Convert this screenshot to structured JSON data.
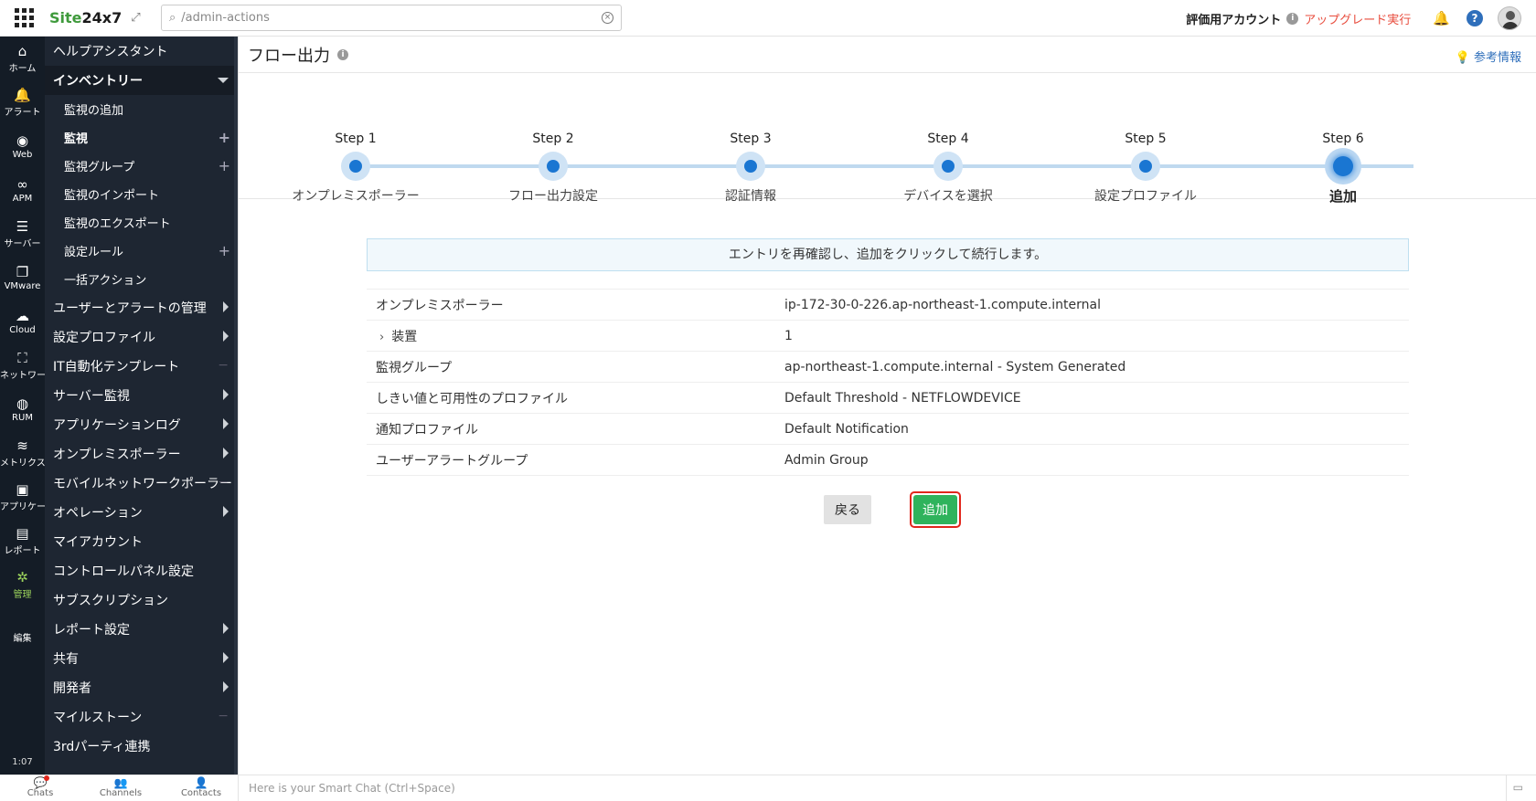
{
  "topbar": {
    "logo_main": "Site24x7",
    "search_value": "/admin-actions",
    "account_label": "評価用アカウント",
    "upgrade_label": "アップグレード実行",
    "help_label": "?"
  },
  "rail": {
    "items": [
      {
        "label": "ホーム",
        "icon": "home-icon",
        "glyph": "⌂"
      },
      {
        "label": "アラート",
        "icon": "bell-icon",
        "glyph": "🔔"
      },
      {
        "label": "Web",
        "icon": "globe-icon",
        "glyph": "◉"
      },
      {
        "label": "APM",
        "icon": "binoculars-icon",
        "glyph": "∞"
      },
      {
        "label": "サーバー",
        "icon": "server-icon",
        "glyph": "☰"
      },
      {
        "label": "VMware",
        "icon": "vmware-icon",
        "glyph": "❐"
      },
      {
        "label": "Cloud",
        "icon": "cloud-icon",
        "glyph": "☁"
      },
      {
        "label": "ネットワーク",
        "icon": "network-icon",
        "glyph": "⛶"
      },
      {
        "label": "RUM",
        "icon": "rum-icon",
        "glyph": "◍"
      },
      {
        "label": "メトリクス",
        "icon": "layers-icon",
        "glyph": "≋"
      },
      {
        "label": "アプリケーション",
        "icon": "app-icon",
        "glyph": "▣"
      },
      {
        "label": "レポート",
        "icon": "report-icon",
        "glyph": "▤"
      },
      {
        "label": "管理",
        "icon": "gear-icon",
        "glyph": "✲"
      },
      {
        "label": "編集",
        "icon": "edit-icon",
        "glyph": ""
      }
    ],
    "time": "1:07"
  },
  "sidebar": {
    "items": [
      {
        "label": "ヘルプアシスタント",
        "type": "top",
        "marker": ""
      },
      {
        "label": "インベントリー",
        "type": "section",
        "marker": "down"
      },
      {
        "label": "監視の追加",
        "type": "sub",
        "marker": ""
      },
      {
        "label": "監視",
        "type": "sub-bold",
        "marker": "plus"
      },
      {
        "label": "監視グループ",
        "type": "sub",
        "marker": "plus"
      },
      {
        "label": "監視のインポート",
        "type": "sub",
        "marker": ""
      },
      {
        "label": "監視のエクスポート",
        "type": "sub",
        "marker": ""
      },
      {
        "label": "設定ルール",
        "type": "sub",
        "marker": "plus"
      },
      {
        "label": "一括アクション",
        "type": "sub",
        "marker": ""
      },
      {
        "label": "ユーザーとアラートの管理",
        "type": "top",
        "marker": "arrow"
      },
      {
        "label": "設定プロファイル",
        "type": "top",
        "marker": "arrow"
      },
      {
        "label": "IT自動化テンプレート",
        "type": "top",
        "marker": "minus"
      },
      {
        "label": "サーバー監視",
        "type": "top",
        "marker": "arrow"
      },
      {
        "label": "アプリケーションログ",
        "type": "top",
        "marker": "arrow"
      },
      {
        "label": "オンプレミスポーラー",
        "type": "top",
        "marker": "arrow"
      },
      {
        "label": "モバイルネットワークポーラー",
        "type": "top",
        "marker": "minus"
      },
      {
        "label": "オペレーション",
        "type": "top",
        "marker": "arrow"
      },
      {
        "label": "マイアカウント",
        "type": "top",
        "marker": ""
      },
      {
        "label": "コントロールパネル設定",
        "type": "top",
        "marker": ""
      },
      {
        "label": "サブスクリプション",
        "type": "top",
        "marker": ""
      },
      {
        "label": "レポート設定",
        "type": "top",
        "marker": "arrow"
      },
      {
        "label": "共有",
        "type": "top",
        "marker": "arrow"
      },
      {
        "label": "開発者",
        "type": "top",
        "marker": "arrow"
      },
      {
        "label": "マイルストーン",
        "type": "top",
        "marker": "minus"
      },
      {
        "label": "3rdパーティ連携",
        "type": "top",
        "marker": ""
      }
    ]
  },
  "page": {
    "title": "フロー出力",
    "reference_label": "参考情報"
  },
  "steps": [
    {
      "step": "Step 1",
      "name": "オンプレミスポーラー"
    },
    {
      "step": "Step 2",
      "name": "フロー出力設定"
    },
    {
      "step": "Step 3",
      "name": "認証情報"
    },
    {
      "step": "Step 4",
      "name": "デバイスを選択"
    },
    {
      "step": "Step 5",
      "name": "設定プロファイル"
    },
    {
      "step": "Step 6",
      "name": "追加"
    }
  ],
  "notice": "エントリを再確認し、追加をクリックして続行します。",
  "summary": [
    {
      "key": "オンプレミスポーラー",
      "value": "ip-172-30-0-226.ap-northeast-1.compute.internal"
    },
    {
      "key": "装置",
      "value": "1"
    },
    {
      "key": "監視グループ",
      "value": "ap-northeast-1.compute.internal - System Generated"
    },
    {
      "key": "しきい値と可用性のプロファイル",
      "value": "Default Threshold - NETFLOWDEVICE"
    },
    {
      "key": "通知プロファイル",
      "value": "Default Notification"
    },
    {
      "key": "ユーザーアラートグループ",
      "value": "Admin Group"
    }
  ],
  "buttons": {
    "back": "戻る",
    "add": "追加"
  },
  "bottombar": {
    "chats": "Chats",
    "channels": "Channels",
    "contacts": "Contacts",
    "chat_placeholder": "Here is your Smart Chat (Ctrl+Space)"
  },
  "colors": {
    "accent": "#1a76d2",
    "add_button": "#2fb35c",
    "highlight_border": "#e1261c",
    "upgrade": "#e84c3d",
    "sidebar_bg": "#1e2632",
    "rail_bg": "#141c26",
    "active_rail": "#9ad15b"
  }
}
